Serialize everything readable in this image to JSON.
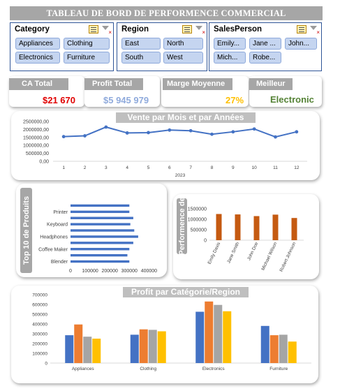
{
  "header": {
    "title": "TABLEAU DE BORD DE PERFORMENCE COMMERCIAL"
  },
  "slicers": {
    "category": {
      "title": "Category",
      "items": [
        "Appliances",
        "Clothing",
        "Electronics",
        "Furniture"
      ]
    },
    "region": {
      "title": "Region",
      "items": [
        "East",
        "North",
        "South",
        "West"
      ]
    },
    "salesperson": {
      "title": "SalesPerson",
      "items": [
        "Emily...",
        "Jane ...",
        "John...",
        "Mich...",
        "Robe..."
      ]
    }
  },
  "kpis": {
    "ca_total": {
      "label": "CA Total",
      "value": "$21 670",
      "color": "#e00000"
    },
    "profit_total": {
      "label": "Profit Total",
      "value": "$5 945 979",
      "color": "#8faadc"
    },
    "marge_moyenne": {
      "label": "Marge Moyenne",
      "value": "27%",
      "color": "#ffc000"
    },
    "meilleur": {
      "label": "Meilleur",
      "value": "Electronic",
      "color": "#548235"
    }
  },
  "colors": {
    "blue": "#4472c4",
    "orange": "#ed7d31",
    "gray": "#a5a5a5",
    "gold": "#ffc000",
    "brown": "#c55a11"
  },
  "chart_data": [
    {
      "type": "line",
      "title": "Vente par Mois et par Années",
      "xlabel": "2023",
      "x": [
        "1",
        "2",
        "3",
        "4",
        "5",
        "6",
        "7",
        "8",
        "9",
        "10",
        "11",
        "12"
      ],
      "values": [
        1550000,
        1600000,
        2150000,
        1780000,
        1800000,
        1960000,
        1920000,
        1700000,
        1850000,
        2030000,
        1530000,
        1850000
      ],
      "y_ticks": [
        "0,00",
        "500000,00",
        "1000000,00",
        "1500000,00",
        "2000000,00",
        "2500000,00"
      ],
      "ylim": [
        0,
        2500000
      ]
    },
    {
      "type": "bar",
      "orientation": "horizontal",
      "title": "Top 10 de Produits",
      "categories": [
        "Blender",
        "",
        "Coffee Maker",
        "",
        "Headphones",
        "",
        "Keyboard",
        "",
        "Printer",
        ""
      ],
      "values": [
        300000,
        290000,
        300000,
        320000,
        345000,
        325000,
        305000,
        320000,
        300000,
        300000
      ],
      "x_ticks": [
        "0",
        "100000",
        "200000",
        "300000",
        "400000"
      ],
      "xlim": [
        0,
        420000
      ]
    },
    {
      "type": "bar",
      "title": "Performence de",
      "categories": [
        "Emily Davis",
        "Jane Smith",
        "John Doe",
        "Michael Wilson",
        "Robert Johnson"
      ],
      "values": [
        1250000,
        1230000,
        1150000,
        1220000,
        1060000
      ],
      "y_ticks": [
        "0",
        "500000",
        "1000000",
        "1500000"
      ],
      "ylim": [
        0,
        1600000
      ]
    },
    {
      "type": "bar",
      "title": "Profit par Catégorie/Region",
      "categories": [
        "Appliances",
        "Clothing",
        "Electronics",
        "Furniture"
      ],
      "series": [
        {
          "values": [
            285000,
            290000,
            525000,
            380000
          ]
        },
        {
          "values": [
            395000,
            345000,
            630000,
            285000
          ]
        },
        {
          "values": [
            270000,
            340000,
            595000,
            290000
          ]
        },
        {
          "values": [
            250000,
            325000,
            530000,
            220000
          ]
        }
      ],
      "y_ticks": [
        "0",
        "100000",
        "200000",
        "300000",
        "400000",
        "500000",
        "600000",
        "700000"
      ],
      "ylim": [
        0,
        700000
      ]
    }
  ]
}
